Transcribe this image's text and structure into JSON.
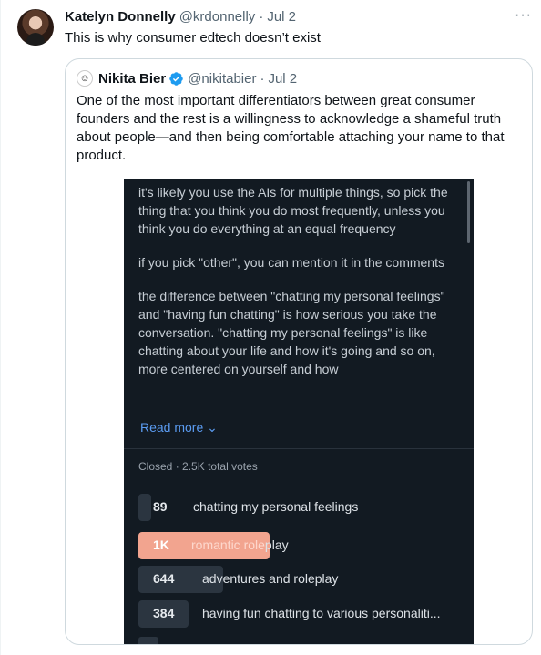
{
  "tweet": {
    "author_name": "Katelyn Donnelly",
    "author_handle": "@krdonnelly",
    "separator": "·",
    "date": "Jul 2",
    "more": "···",
    "text": "This is why consumer edtech doesn’t exist"
  },
  "quote": {
    "author_name": "Nikita Bier",
    "author_handle": "@nikitabier",
    "separator": "·",
    "date": "Jul 2",
    "avatar_glyph": "☺",
    "text": "One of the most important differentiators between great consumer founders and the rest is a willingness to acknowledge a shameful truth about people—and then being comfortable attaching your name to that product."
  },
  "screenshot": {
    "paragraphs": [
      "it's likely you use the AIs for multiple things, so pick the thing that you think you do most frequently, unless you think you do everything at an equal frequency",
      "if you pick \"other\", you can mention it in the comments",
      "the difference between \"chatting my personal feelings\" and \"having fun chatting\" is how serious you take the conversation. \"chatting my personal feelings\" is like chatting about your life and how it's going and so on, more centered on yourself and how"
    ],
    "read_more": "Read more ⌄",
    "poll_status": "Closed",
    "poll_separator": "·",
    "poll_votes": "2.5K total votes",
    "options": [
      {
        "count": "89",
        "label": "chatting my personal feelings",
        "share": 0.036
      },
      {
        "count": "1K",
        "label_over": "romantic role",
        "label_rest": "play",
        "share": 0.4
      },
      {
        "count": "644",
        "label": "adventures and roleplay",
        "share": 0.258
      },
      {
        "count": "384",
        "label": "having fun chatting to various personaliti...",
        "share": 0.154
      }
    ]
  },
  "colors": {
    "verified": "#1d9bf0",
    "poll_winner": "#f2a48f",
    "poll_bar": "#2b3540",
    "link": "#5b9cf2"
  }
}
